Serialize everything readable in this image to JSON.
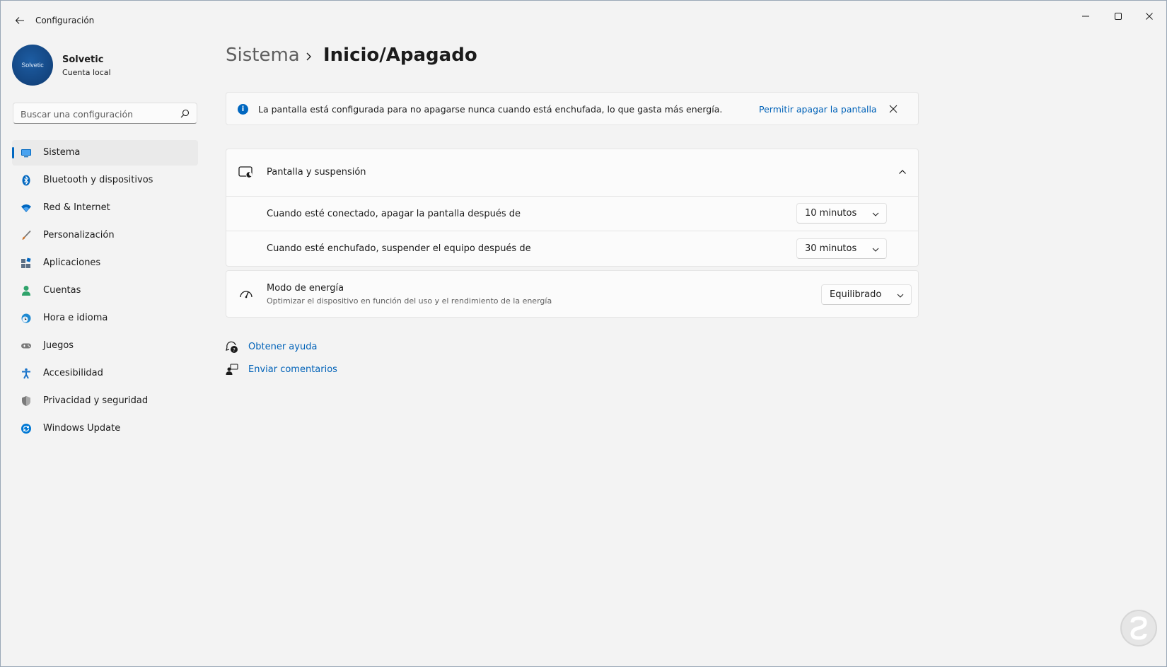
{
  "window": {
    "title": "Configuración",
    "controls": [
      "minimize",
      "maximize",
      "close"
    ]
  },
  "profile": {
    "name": "Solvetic",
    "account_type": "Cuenta local",
    "avatar_text": "Solvetic"
  },
  "search": {
    "placeholder": "Buscar una configuración",
    "value": ""
  },
  "sidebar": {
    "items": [
      {
        "label": "Sistema",
        "icon": "monitor-icon",
        "color": "#0067c0",
        "selected": true
      },
      {
        "label": "Bluetooth y dispositivos",
        "icon": "bluetooth-icon",
        "color": "#0067c0"
      },
      {
        "label": "Red & Internet",
        "icon": "wifi-icon",
        "color": "#0067c0"
      },
      {
        "label": "Personalización",
        "icon": "brush-icon",
        "color": "#c9732d"
      },
      {
        "label": "Aplicaciones",
        "icon": "apps-icon",
        "color": "#5b6f85"
      },
      {
        "label": "Cuentas",
        "icon": "person-icon",
        "color": "#2fa36b"
      },
      {
        "label": "Hora e idioma",
        "icon": "globe-clock-icon",
        "color": "#1f8ad2"
      },
      {
        "label": "Juegos",
        "icon": "gamepad-icon",
        "color": "#7a7a7a"
      },
      {
        "label": "Accesibilidad",
        "icon": "accessibility-icon",
        "color": "#1a73c9"
      },
      {
        "label": "Privacidad y seguridad",
        "icon": "shield-icon",
        "color": "#7a7a7a"
      },
      {
        "label": "Windows Update",
        "icon": "update-icon",
        "color": "#0078d4"
      }
    ]
  },
  "header": {
    "parent": "Sistema",
    "current": "Inicio/Apagado"
  },
  "infobar": {
    "message": "La pantalla está configurada para no apagarse nunca cuando está enchufada, lo que gasta más energía.",
    "action": "Permitir apagar la pantalla"
  },
  "screen_sleep": {
    "title": "Pantalla y suspensión",
    "expanded": true,
    "rows": [
      {
        "label": "Cuando esté conectado, apagar la pantalla después de",
        "value": "10 minutos"
      },
      {
        "label": "Cuando esté enchufado, suspender el equipo después de",
        "value": "30 minutos"
      }
    ]
  },
  "power_mode": {
    "title": "Modo de energía",
    "description": "Optimizar el dispositivo en función del uso y el rendimiento de la energía",
    "value": "Equilibrado"
  },
  "links": {
    "help": "Obtener ayuda",
    "feedback": "Enviar comentarios"
  },
  "colors": {
    "accent": "#0067c0",
    "link": "#0062b8",
    "background": "#f3f3f3",
    "card": "#fbfbfb"
  }
}
